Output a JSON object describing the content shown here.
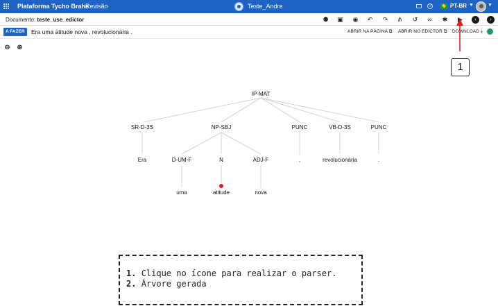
{
  "topbar": {
    "brand": "Plataforma Tycho Brahe",
    "mode": "Revisão",
    "user": "Teste_Andre",
    "language": "PT-BR"
  },
  "docbar": {
    "label": "Documento:",
    "name": "teste_use_edictor",
    "tools": [
      "users-icon",
      "save-icon",
      "eye-icon",
      "undo-icon",
      "redo-icon",
      "split-icon",
      "history-icon",
      "link-icon",
      "bug-icon",
      "play-icon",
      "prev-circle-icon",
      "next-circle-icon"
    ]
  },
  "sentence_bar": {
    "status_badge": "A FAZER",
    "sentence": "Era uma atitude nova , revolucionária .",
    "open_page": "ABRIR NA PÁGINA",
    "open_edictor": "ABRIR NO EDICTOR",
    "download": "DOWNLOAD"
  },
  "tree": {
    "root": "IP-MAT",
    "level1": [
      "SR-D-3S",
      "NP-SBJ",
      "PUNC",
      "VB-D-3S",
      "PUNC"
    ],
    "level2": [
      "Era",
      "D-UM-F",
      "N",
      "ADJ-F",
      ",",
      "revolucionária",
      "."
    ],
    "level3": [
      "uma",
      "atitude",
      "nova"
    ]
  },
  "annotation": {
    "marker": "1",
    "step1_num": "1.",
    "step1_text": "Clique no ícone para realizar o parser.",
    "step2_num": "2.",
    "step2_text": "Árvore gerada"
  },
  "colors": {
    "brand_blue": "#1e63c4",
    "status_green": "#1f9a5c",
    "arrow_red": "#e21d1d"
  }
}
